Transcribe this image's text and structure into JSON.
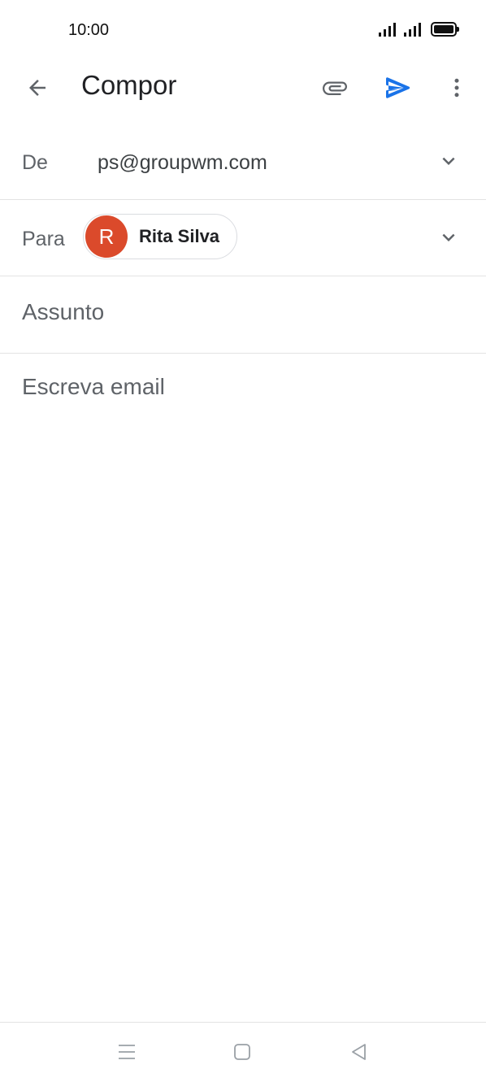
{
  "status_bar": {
    "time": "10:00"
  },
  "app_bar": {
    "title": "Compor",
    "icons": {
      "back": "arrow-left",
      "attach": "paperclip",
      "send": "send",
      "more": "more-vertical"
    },
    "send_color": "#1a73e8"
  },
  "compose": {
    "from_label": "De",
    "from_value": "ps@groupwm.com",
    "to_label": "Para",
    "recipient": {
      "initial": "R",
      "name": "Rita Silva",
      "avatar_color": "#db4a2b"
    },
    "subject_placeholder": "Assunto",
    "body_placeholder": "Escreva email"
  },
  "nav_bar": {
    "icons": [
      "menu",
      "home-square",
      "back-triangle"
    ]
  }
}
